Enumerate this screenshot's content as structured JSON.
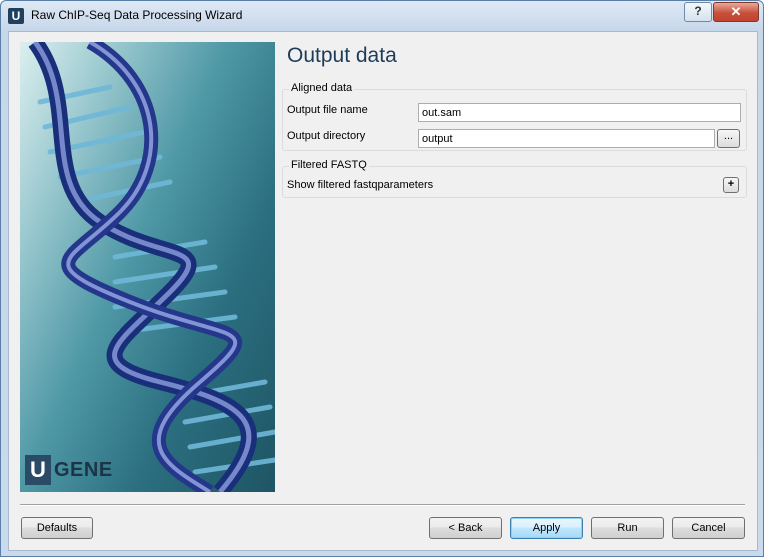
{
  "window": {
    "title": "Raw ChIP-Seq Data Processing Wizard",
    "app_icon_letter": "U",
    "help_label": "?",
    "close_label": "✕"
  },
  "side_image": {
    "logo_letter": "U",
    "logo_text": "GENE"
  },
  "page": {
    "title": "Output data"
  },
  "aligned_group": {
    "title": "Aligned data",
    "output_file_label": "Output file name",
    "output_file_value": "out.sam",
    "output_dir_label": "Output directory",
    "output_dir_value": "output",
    "browse_label": "..."
  },
  "filtered_group": {
    "title": "Filtered FASTQ",
    "show_label": "Show filtered fastqparameters",
    "expand_label": "+"
  },
  "buttons": {
    "defaults": "Defaults",
    "back": "< Back",
    "apply": "Apply",
    "run": "Run",
    "cancel": "Cancel"
  }
}
